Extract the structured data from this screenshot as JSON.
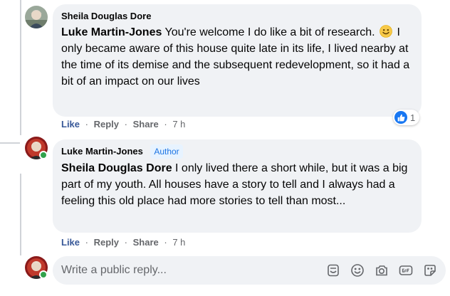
{
  "comment1": {
    "author": "Sheila Douglas Dore",
    "mention": "Luke Martin-Jones",
    "text_before_emoji": " You're welcome I do like a bit of research.",
    "text_after_emoji": " I only became aware of this house quite late in its life, I lived nearby at the time of its demise and the subsequent redevelopment, so it had a bit of an impact on our lives",
    "reaction_count": "1",
    "actions": {
      "like": "Like",
      "reply": "Reply",
      "share": "Share",
      "time": "7 h"
    }
  },
  "comment2": {
    "author": "Luke Martin-Jones",
    "badge": "Author",
    "mention": "Sheila Douglas Dore",
    "text": " I only lived there a short while, but it was a big part of my youth. All houses have a story to tell and I always had a feeling this old place had more stories to tell than most...",
    "actions": {
      "like": "Like",
      "reply": "Reply",
      "share": "Share",
      "time": "7 h"
    }
  },
  "reply_box": {
    "placeholder": "Write a public reply...",
    "tools": [
      "sticker-face-icon",
      "emoji-icon",
      "camera-icon",
      "gif-icon",
      "sticker-icon"
    ]
  },
  "separator": "·",
  "colors": {
    "like_blue": "#1877f2",
    "bubble": "#f0f2f5",
    "online": "#31a24c"
  }
}
